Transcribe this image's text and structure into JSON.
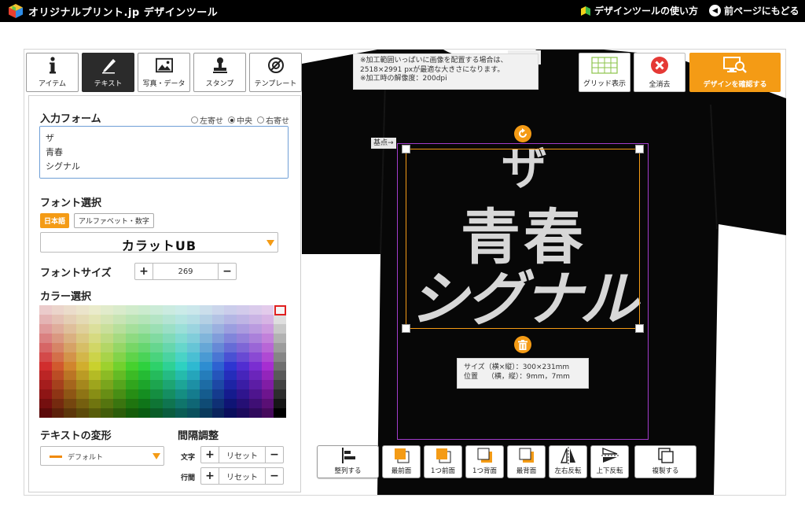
{
  "header": {
    "brand": "オリジナルプリント.jp  デザインツール",
    "guide_link": "デザインツールの使い方",
    "back_link": "前ページにもどる"
  },
  "tabs": [
    {
      "label": "アイテム",
      "icon": "info-i-icon",
      "active": false
    },
    {
      "label": "テキスト",
      "icon": "pen-icon",
      "active": true
    },
    {
      "label": "写真・データ",
      "icon": "image-icon",
      "active": false
    },
    {
      "label": "スタンプ",
      "icon": "stamp-icon",
      "active": false
    },
    {
      "label": "テンプレート",
      "icon": "template-icon",
      "active": false
    }
  ],
  "text_panel": {
    "input_title": "入力フォーム",
    "align": {
      "left": "左寄せ",
      "center": "中央",
      "right": "右寄せ",
      "selected": "center"
    },
    "input_value": "ザ\n青春\nシグナル",
    "font_title": "フォント選択",
    "font_tab_jp": "日本語",
    "font_tab_alpha": "アルファベット・数字",
    "font_name": "カラットUB",
    "size_title": "フォントサイズ",
    "size_value": "269",
    "color_title": "カラー選択",
    "transform_title": "テキストの変形",
    "transform_value": "デフォルト",
    "spacing_title": "間隔調整",
    "char_label": "文字",
    "line_label": "行間",
    "reset_label": "リセット"
  },
  "canvas": {
    "note_lines": [
      "※加工範囲いっぱいに画像を配置する場合は、",
      "2518×2991 pxが最適な大きさになります。",
      "※加工時の解像度：200dpi"
    ],
    "base_label": "基点",
    "design_lines": [
      "ザ",
      "青春",
      "シグナル"
    ],
    "size_info": "サイズ（横×縦）：300×231mm",
    "position_info": "位置　 （横，縦）：9mm，7mm",
    "text_color": "#d7d7d7",
    "selection_color": "#f49b15",
    "print_area_color": "#a23ccb"
  },
  "toolbar": {
    "grid": "グリッド表示",
    "clear": "全消去",
    "confirm": "デザインを確認する"
  },
  "bottom_tools": {
    "align": "整列する",
    "front": "最前面",
    "forward": "1つ前面",
    "backward": "1つ背面",
    "back": "最背面",
    "flip_h": "左右反転",
    "flip_v": "上下反転",
    "duplicate": "複製する"
  }
}
